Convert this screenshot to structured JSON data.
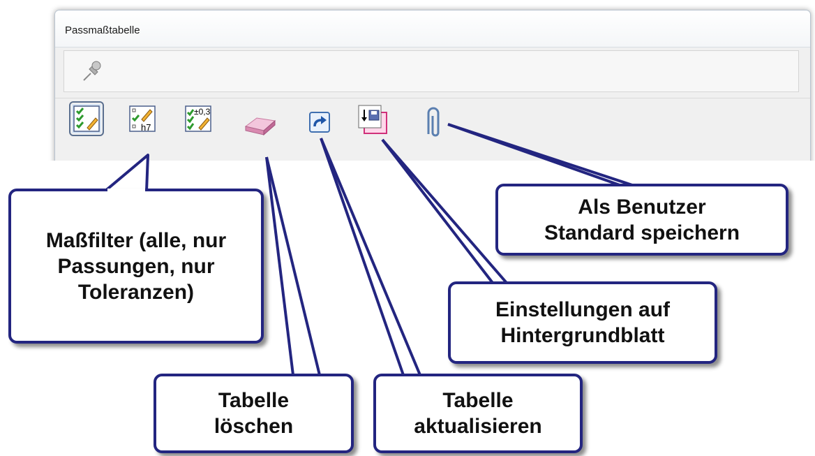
{
  "window": {
    "title": "Passmaßtabelle"
  },
  "toolbar": {
    "pin": "pin-icon",
    "buttons": [
      {
        "name": "filter-all-button",
        "icon": "check-list-pencil-icon"
      },
      {
        "name": "filter-fits-button",
        "icon": "check-list-h7-icon",
        "label": "h7"
      },
      {
        "name": "filter-tolerances-button",
        "icon": "check-list-tolerance-icon",
        "label": "±0,3"
      },
      {
        "name": "delete-table-button",
        "icon": "eraser-icon"
      },
      {
        "name": "refresh-table-button",
        "icon": "refresh-arrow-icon"
      },
      {
        "name": "save-to-background-button",
        "icon": "save-sheet-icon"
      },
      {
        "name": "save-user-default-button",
        "icon": "paperclip-icon"
      }
    ]
  },
  "callouts": {
    "filter": "Maßfilter (alle, nur\nPassungen, nur\nToleranzen)",
    "delete": "Tabelle\nlöschen",
    "refresh": "Tabelle\naktualisieren",
    "background": "Einstellungen auf\nHintergrundblatt",
    "user_default": "Als Benutzer\nStandard speichern"
  },
  "colors": {
    "callout_border": "#232580",
    "check_green": "#3aa83a",
    "eraser_pink": "#e8a6c8"
  }
}
